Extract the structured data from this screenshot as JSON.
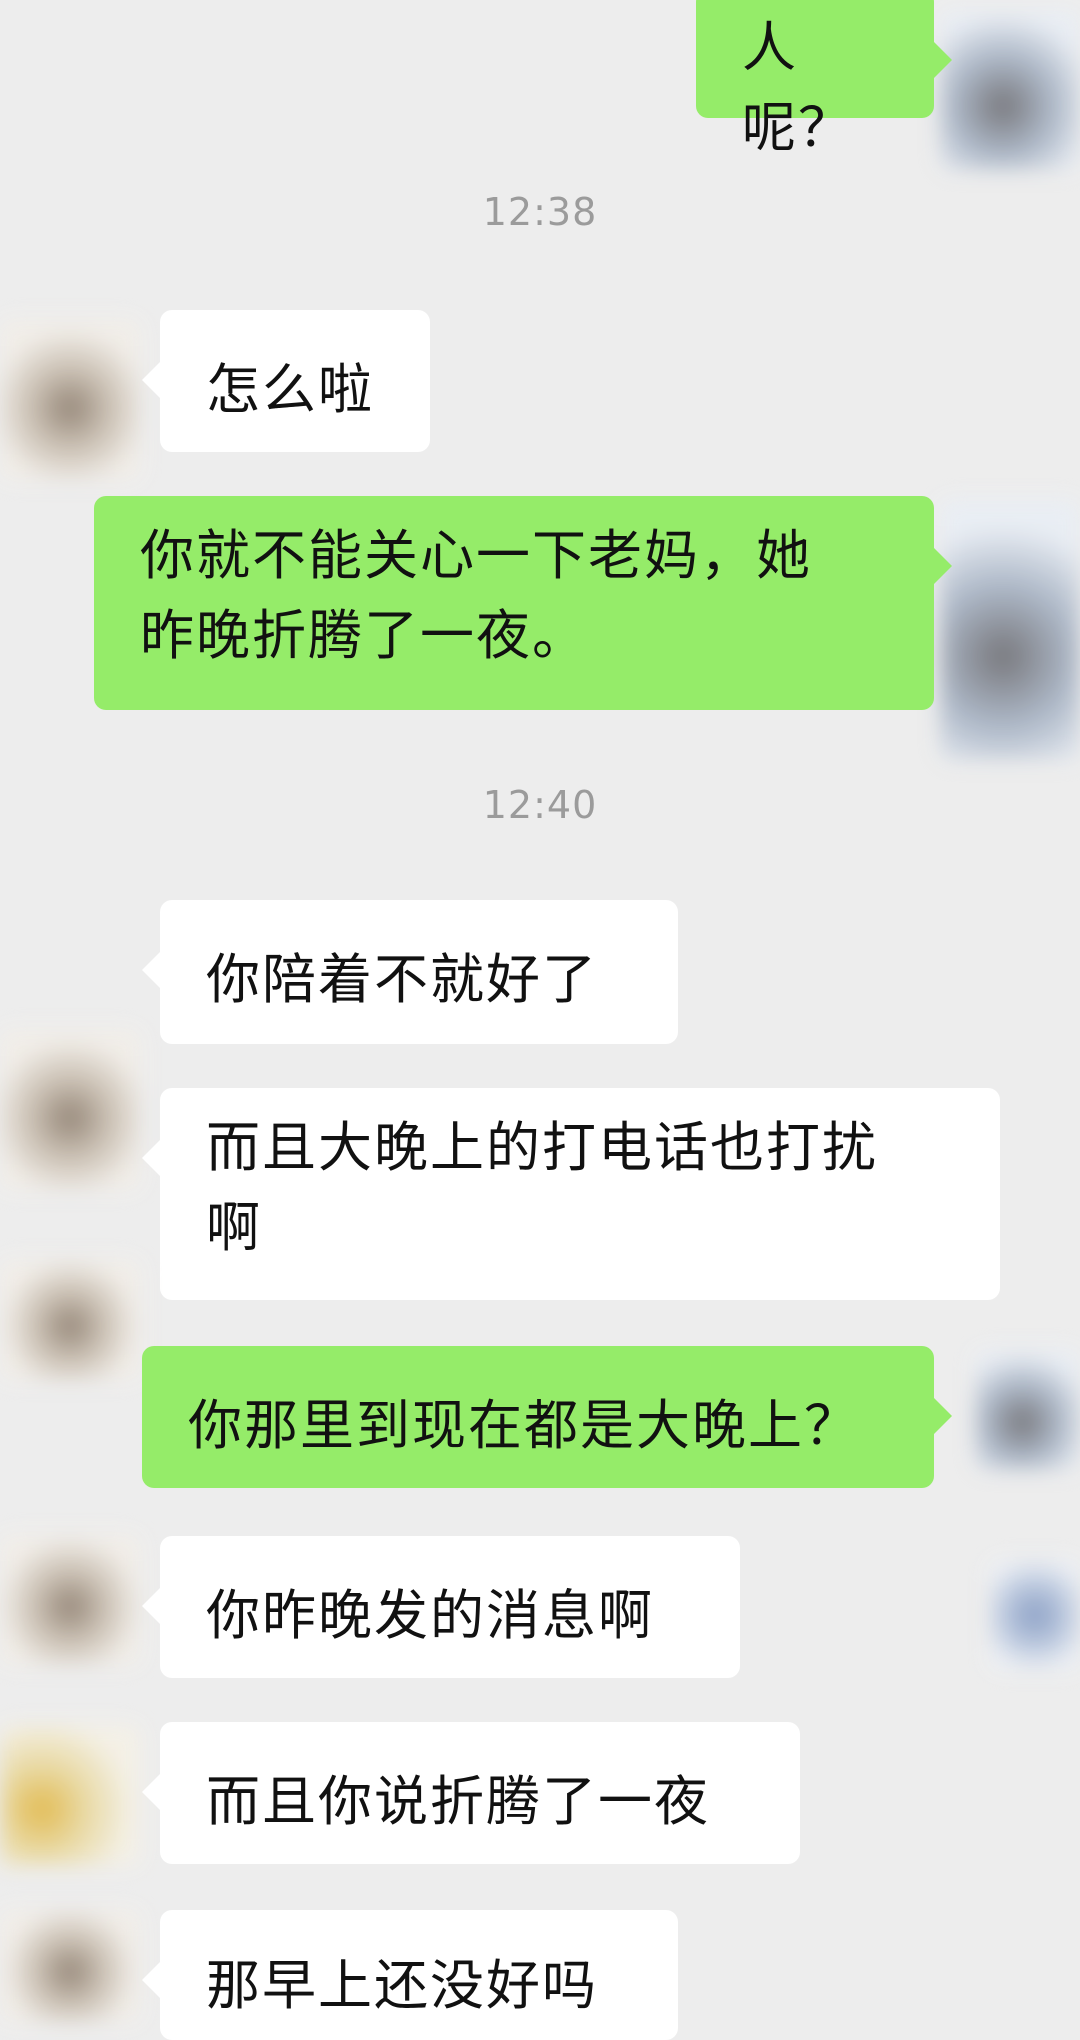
{
  "colors": {
    "background": "#ededed",
    "incoming_bubble": "#ffffff",
    "outgoing_bubble": "#95ec69",
    "timestamp": "#9b9b9b"
  },
  "timestamps": [
    "12:38",
    "12:40"
  ],
  "messages": [
    {
      "from": "me",
      "text": "人呢？"
    },
    {
      "from": "other",
      "text": "怎么啦"
    },
    {
      "from": "me",
      "line1": "你就不能关心一下老妈，她",
      "line2": "昨晚折腾了一夜。"
    },
    {
      "from": "other",
      "text": "你陪着不就好了"
    },
    {
      "from": "other",
      "line1": "而且大晚上的打电话也打扰",
      "line2": "啊"
    },
    {
      "from": "me",
      "text": "你那里到现在都是大晚上？"
    },
    {
      "from": "other",
      "text": "你昨晚发的消息啊"
    },
    {
      "from": "other",
      "text": "而且你说折腾了一夜"
    },
    {
      "from": "other",
      "text": "那早上还没好吗"
    }
  ]
}
